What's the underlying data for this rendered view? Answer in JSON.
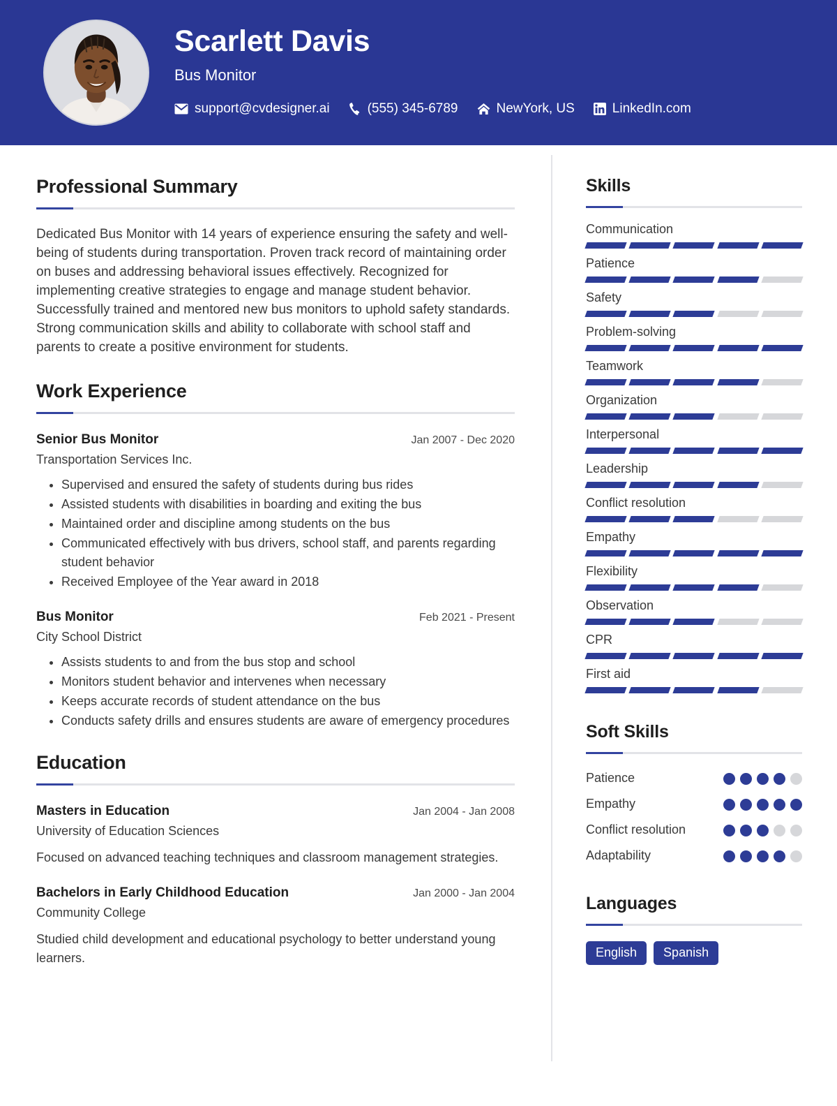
{
  "theme": {
    "header_bg": "#2A3794",
    "accent": "#2D3C96",
    "muted_bar": "#d6d7da",
    "rule": "#e2e3e7"
  },
  "header": {
    "name": "Scarlett Davis",
    "role": "Bus Monitor",
    "avatar_alt": "profile-photo",
    "contacts": [
      {
        "icon": "envelope-icon",
        "text": "support@cvdesigner.ai"
      },
      {
        "icon": "phone-icon",
        "text": "(555) 345-6789"
      },
      {
        "icon": "home-icon",
        "text": "NewYork, US"
      },
      {
        "icon": "linkedin-icon",
        "text": "LinkedIn.com"
      }
    ]
  },
  "summary": {
    "title": "Professional Summary",
    "text": "Dedicated Bus Monitor with 14 years of experience ensuring the safety and well-being of students during transportation. Proven track record of maintaining order on buses and addressing behavioral issues effectively. Recognized for implementing creative strategies to engage and manage student behavior. Successfully trained and mentored new bus monitors to uphold safety standards. Strong communication skills and ability to collaborate with school staff and parents to create a positive environment for students."
  },
  "experience": {
    "title": "Work Experience",
    "entries": [
      {
        "title": "Senior Bus Monitor",
        "date": "Jan 2007 - Dec 2020",
        "org": "Transportation Services Inc.",
        "bullets": [
          "Supervised and ensured the safety of students during bus rides",
          "Assisted students with disabilities in boarding and exiting the bus",
          "Maintained order and discipline among students on the bus",
          "Communicated effectively with bus drivers, school staff, and parents regarding student behavior",
          "Received Employee of the Year award in 2018"
        ]
      },
      {
        "title": "Bus Monitor",
        "date": "Feb 2021 - Present",
        "org": "City School District",
        "bullets": [
          "Assists students to and from the bus stop and school",
          "Monitors student behavior and intervenes when necessary",
          "Keeps accurate records of student attendance on the bus",
          "Conducts safety drills and ensures students are aware of emergency procedures"
        ]
      }
    ]
  },
  "education": {
    "title": "Education",
    "entries": [
      {
        "title": "Masters in Education",
        "date": "Jan 2004 - Jan 2008",
        "org": "University of Education Sciences",
        "desc": "Focused on advanced teaching techniques and classroom management strategies."
      },
      {
        "title": "Bachelors in Early Childhood Education",
        "date": "Jan 2000 - Jan 2004",
        "org": "Community College",
        "desc": "Studied child development and educational psychology to better understand young learners."
      }
    ]
  },
  "skills": {
    "title": "Skills",
    "max": 5,
    "items": [
      {
        "name": "Communication",
        "level": 5
      },
      {
        "name": "Patience",
        "level": 4
      },
      {
        "name": "Safety",
        "level": 3
      },
      {
        "name": "Problem-solving",
        "level": 5
      },
      {
        "name": "Teamwork",
        "level": 4
      },
      {
        "name": "Organization",
        "level": 3
      },
      {
        "name": "Interpersonal",
        "level": 5
      },
      {
        "name": "Leadership",
        "level": 4
      },
      {
        "name": "Conflict resolution",
        "level": 3
      },
      {
        "name": "Empathy",
        "level": 5
      },
      {
        "name": "Flexibility",
        "level": 4
      },
      {
        "name": "Observation",
        "level": 3
      },
      {
        "name": "CPR",
        "level": 5
      },
      {
        "name": "First aid",
        "level": 4
      }
    ]
  },
  "soft_skills": {
    "title": "Soft Skills",
    "max": 5,
    "items": [
      {
        "name": "Patience",
        "level": 4
      },
      {
        "name": "Empathy",
        "level": 5
      },
      {
        "name": "Conflict resolution",
        "level": 3
      },
      {
        "name": "Adaptability",
        "level": 4
      }
    ]
  },
  "languages": {
    "title": "Languages",
    "items": [
      "English",
      "Spanish"
    ]
  }
}
